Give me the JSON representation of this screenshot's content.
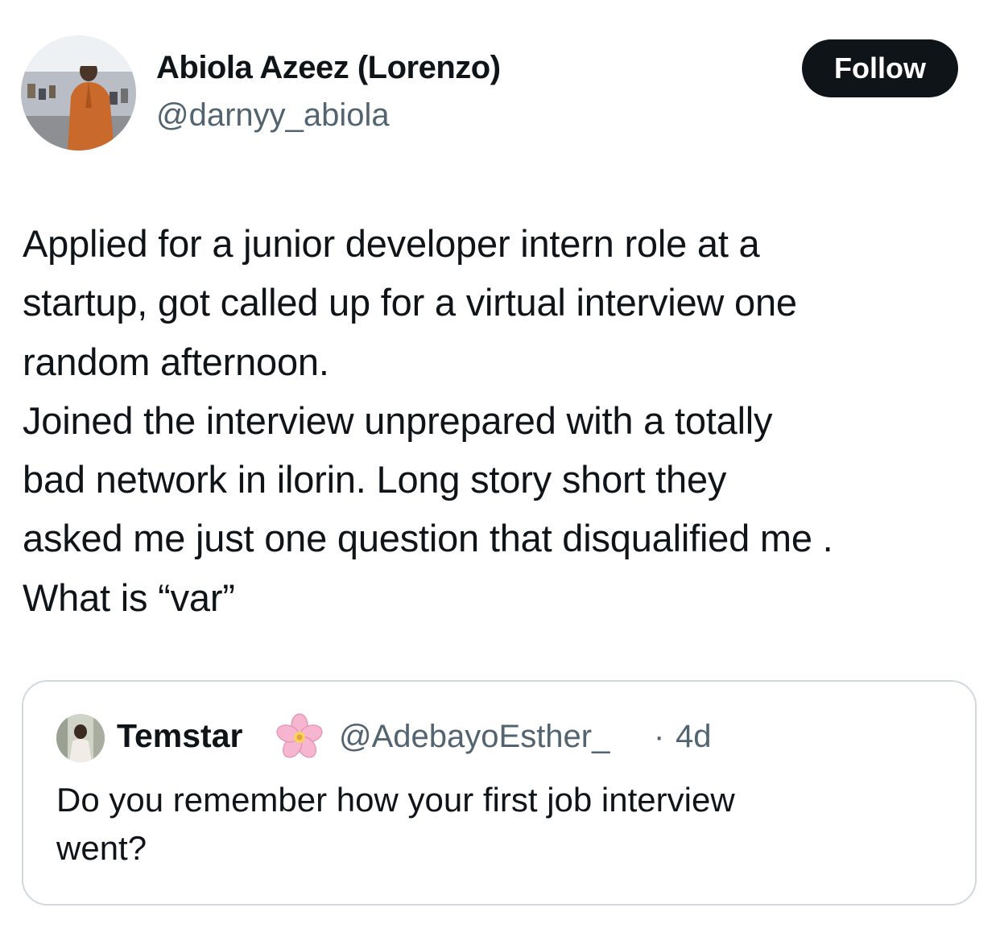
{
  "tweet": {
    "author": {
      "name": "Abiola Azeez (Lorenzo)",
      "handle": "@darnyy_abiola",
      "avatar_icon": "profile-photo"
    },
    "follow_label": "Follow",
    "text_lines": [
      "Applied for a junior developer intern role at a",
      "startup, got called up for a virtual interview one",
      "random afternoon.",
      "Joined the interview unprepared with a totally",
      "bad network in ilorin.  Long story short they",
      "asked me just one question that disqualified me .",
      "What is “var”"
    ]
  },
  "quoted_tweet": {
    "author_name": "Temstar",
    "name_emoji": "cherry-blossom-icon",
    "handle": "@AdebayoEsther_",
    "separator": "·",
    "time": "4d",
    "text_lines": [
      "Do you remember how your first job interview",
      "went?"
    ]
  },
  "colors": {
    "text_primary": "#0f1419",
    "text_secondary": "#536471",
    "button_bg": "#0f1419",
    "button_text": "#ffffff",
    "border": "#cfd9de"
  }
}
